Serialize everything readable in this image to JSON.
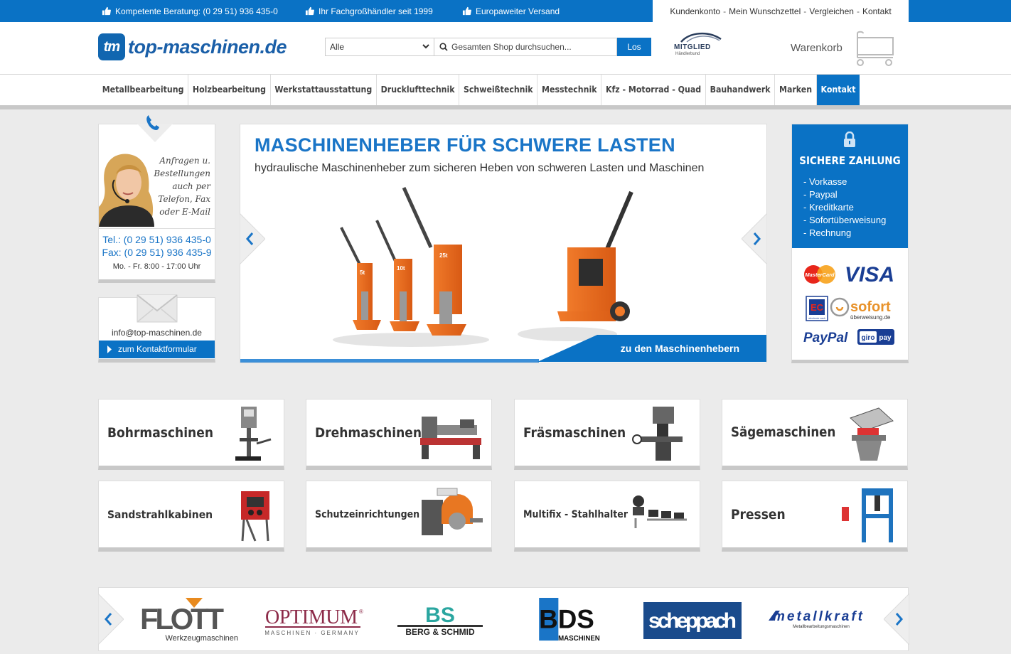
{
  "topbar": {
    "usps": [
      "Kompetente Beratung: (0 29 51) 936 435-0",
      "Ihr Fachgroßhändler seit 1999",
      "Europaweiter Versand"
    ],
    "links": [
      "Kundenkonto",
      "Mein Wunschzettel",
      "Vergleichen",
      "Kontakt"
    ],
    "separator": "-"
  },
  "header": {
    "logo_mark": "tm",
    "logo_text": "top-maschinen.de",
    "search": {
      "category": "Alle",
      "placeholder": "Gesamten Shop durchsuchen...",
      "button": "Los"
    },
    "member": {
      "line1": "MITGLIED",
      "line2": "Händlerbund"
    },
    "cart_label": "Warenkorb"
  },
  "nav": {
    "items": [
      "Metallbearbeitung",
      "Holzbearbeitung",
      "Werkstattausstattung",
      "Drucklufttechnik",
      "Schweißtechnik",
      "Messtechnik",
      "Kfz - Motorrad - Quad",
      "Bauhandwerk",
      "Marken",
      "Kontakt"
    ],
    "active_index": 9
  },
  "contact": {
    "note": [
      "Anfragen u.",
      "Bestellungen",
      "auch per",
      "Telefon, Fax",
      "oder E-Mail"
    ],
    "tel": "Tel.: (0 29 51) 936 435-0",
    "fax": "Fax: (0 29 51) 936 435-9",
    "hours": "Mo. - Fr. 8:00 - 17:00 Uhr",
    "email": "info@top-maschinen.de",
    "form_link": "zum Kontaktformular"
  },
  "slider": {
    "title": "MASCHINENHEBER FÜR SCHWERE LASTEN",
    "subtitle": "hydraulische Maschinenheber zum sicheren Heben von schweren Lasten und Maschinen",
    "cta": "zu den Maschinenhebern",
    "jack_labels": [
      "5t",
      "10t",
      "25t"
    ]
  },
  "payment": {
    "title": "SICHERE ZAHLUNG",
    "methods": [
      "- Vorkasse",
      "- Paypal",
      "- Kreditkarte",
      "- Sofortüberweisung",
      "- Rechnung"
    ],
    "logos": {
      "mastercard": "MasterCard",
      "visa": "VISA",
      "ec": "EC",
      "ec_sub": "electronic cash",
      "sofort": "sofort",
      "sofort_sub": "überweisung.de",
      "paypal": "PayPal",
      "giropay_a": "giro",
      "giropay_b": "pay"
    }
  },
  "categories": [
    "Bohrmaschinen",
    "Drehmaschinen",
    "Fräsmaschinen",
    "Sägemaschinen",
    "Sandstrahlkabinen",
    "Schutzeinrichtungen",
    "Multifix - Stahlhalter",
    "Pressen"
  ],
  "brands": {
    "flott": "FLOTT",
    "flott_sub": "Werkzeugmaschinen",
    "optimum": "OPTIMUM",
    "optimum_reg": "®",
    "optimum_sub": "MASCHINEN · GERMANY",
    "bs_mark": "BS",
    "bs": "BERG & SCHMID",
    "bds": "BDS",
    "bds_sub": "MASCHINEN",
    "scheppach": "scheppach",
    "metallkraft": "metallkraft",
    "metallkraft_sub": "Metallbearbeitungsmaschinen"
  },
  "colors": {
    "brand_blue": "#0a72c5",
    "link_blue": "#1a75c7",
    "background": "#ebebeb"
  }
}
